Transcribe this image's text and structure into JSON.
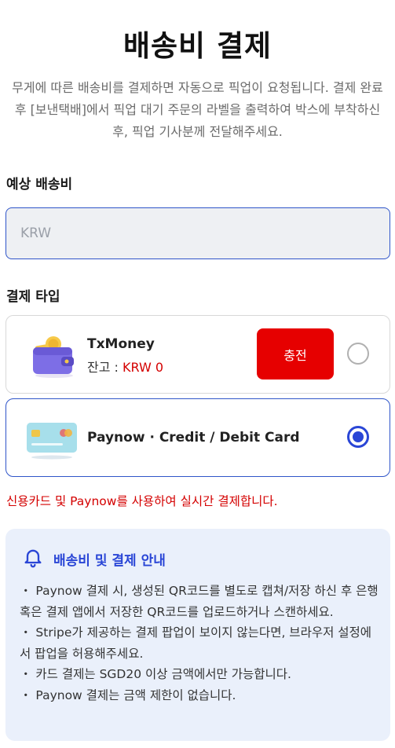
{
  "page": {
    "title": "배송비 결제",
    "description": "무게에 따른 배송비를 결제하면 자동으로 픽업이 요청됩니다. 결제 완료 후 [보낸택배]에서 픽업 대기 주문의 라벨을 출력하여 박스에 부착하신 후, 픽업 기사분께 전달해주세요."
  },
  "estimated_fee": {
    "label": "예상 배송비",
    "placeholder": "KRW",
    "value": ""
  },
  "payment_type": {
    "label": "결제 타입",
    "options": [
      {
        "name": "TxMoney",
        "balance_label": "잔고 : ",
        "balance_value": "KRW 0",
        "charge_label": "충전",
        "selected": false,
        "icon": "wallet-icon"
      },
      {
        "name": "Paynow · Credit / Debit Card",
        "selected": true,
        "icon": "credit-card-icon"
      }
    ],
    "note": "신용카드 및 Paynow를 사용하여 실시간 결제합니다."
  },
  "info": {
    "title": "배송비 및 결제 안내",
    "icon": "bell-icon",
    "items": [
      "・ Paynow 결제 시, 생성된 QR코드를 별도로 캡쳐/저장 하신 후 은행 혹은 결제 앱에서 저장한 QR코드를 업로드하거나 스캔하세요.",
      "・ Stripe가 제공하는 결제 팝업이 보이지 않는다면, 브라우저 설정에서 팝업을 허용해주세요.",
      "・ 카드 결제는 SGD20 이상 금액에서만 가능합니다.",
      "・ Paynow 결제는 금액 제한이 없습니다."
    ]
  },
  "colors": {
    "accent": "#2a46d6",
    "danger": "#e60000",
    "info_bg": "#eaf0fb"
  }
}
